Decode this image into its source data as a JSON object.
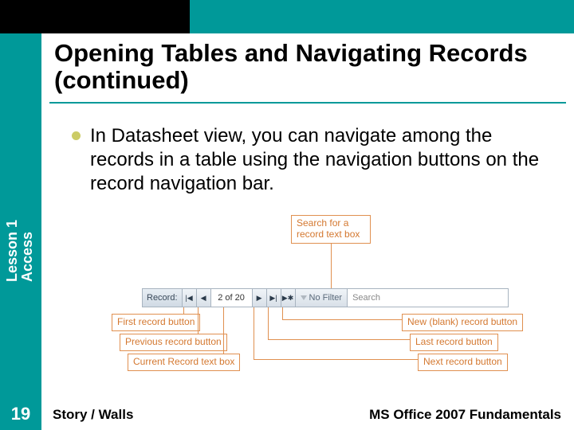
{
  "title": "Opening Tables and Navigating Records (continued)",
  "bullet": "In Datasheet view, you can navigate among the records in a table using the navigation buttons on the record navigation bar.",
  "navbar": {
    "label": "Record:",
    "first_glyph": "|◀",
    "prev_glyph": "◀",
    "current": "2 of 20",
    "next_glyph": "▶",
    "last_glyph": "▶|",
    "new_glyph": "▶✱",
    "filter": "No Filter",
    "search": "Search"
  },
  "callouts": {
    "search_box": "Search for a\nrecord text box",
    "first": "First record button",
    "prev": "Previous record button",
    "current": "Current Record text box",
    "new": "New (blank) record button",
    "last": "Last record button",
    "next": "Next record button"
  },
  "sidebar": {
    "line1": "Access",
    "line2": "Lesson 1"
  },
  "page_number": "19",
  "footer": {
    "left": "Story / Walls",
    "right": "MS Office 2007 Fundamentals"
  }
}
